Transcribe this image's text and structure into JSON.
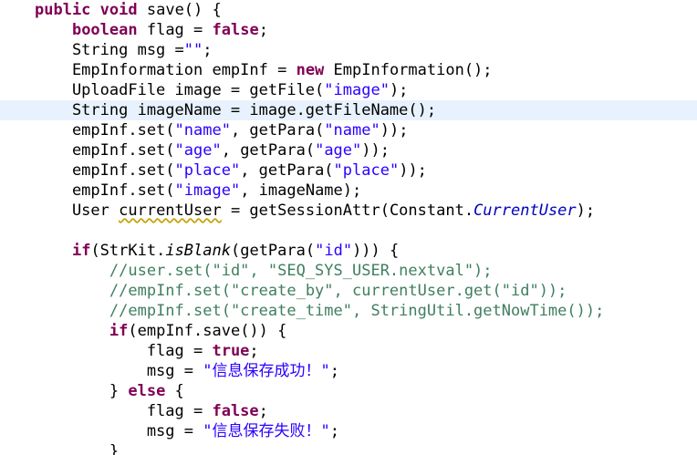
{
  "editor": {
    "theme": {
      "keyword_color": "#7f0055",
      "string_color": "#2a00ff",
      "comment_color": "#3f7f5f",
      "field_color": "#0000c0",
      "current_line_color": "#e8f2fe"
    },
    "highlighted_line_index": 5,
    "lines": [
      [
        {
          "t": "public",
          "c": "kw"
        },
        {
          "t": " "
        },
        {
          "t": "void",
          "c": "kw"
        },
        {
          "t": " save() {"
        }
      ],
      [
        {
          "t": "    "
        },
        {
          "t": "boolean",
          "c": "kw"
        },
        {
          "t": " flag = "
        },
        {
          "t": "false",
          "c": "kw"
        },
        {
          "t": ";"
        }
      ],
      [
        {
          "t": "    String msg ="
        },
        {
          "t": "\"\"",
          "c": "str"
        },
        {
          "t": ";"
        }
      ],
      [
        {
          "t": "    EmpInformation empInf = "
        },
        {
          "t": "new",
          "c": "kw"
        },
        {
          "t": " EmpInformation();"
        }
      ],
      [
        {
          "t": "    UploadFile image = getFile("
        },
        {
          "t": "\"image\"",
          "c": "str"
        },
        {
          "t": ");"
        }
      ],
      [
        {
          "t": "    String imageName = image.getFileName();"
        }
      ],
      [
        {
          "t": "    empInf.set("
        },
        {
          "t": "\"name\"",
          "c": "str"
        },
        {
          "t": ", getPara("
        },
        {
          "t": "\"name\"",
          "c": "str"
        },
        {
          "t": "));"
        }
      ],
      [
        {
          "t": "    empInf.set("
        },
        {
          "t": "\"age\"",
          "c": "str"
        },
        {
          "t": ", getPara("
        },
        {
          "t": "\"age\"",
          "c": "str"
        },
        {
          "t": "));"
        }
      ],
      [
        {
          "t": "    empInf.set("
        },
        {
          "t": "\"place\"",
          "c": "str"
        },
        {
          "t": ", getPara("
        },
        {
          "t": "\"place\"",
          "c": "str"
        },
        {
          "t": "));"
        }
      ],
      [
        {
          "t": "    empInf.set("
        },
        {
          "t": "\"image\"",
          "c": "str"
        },
        {
          "t": ", imageName);"
        }
      ],
      [
        {
          "t": "    User "
        },
        {
          "t": "currentUser",
          "c": "warn"
        },
        {
          "t": " = getSessionAttr(Constant."
        },
        {
          "t": "CurrentUser",
          "c": "field"
        },
        {
          "t": ");"
        }
      ],
      [
        {
          "t": ""
        }
      ],
      [
        {
          "t": "    "
        },
        {
          "t": "if",
          "c": "kw"
        },
        {
          "t": "(StrKit."
        },
        {
          "t": "isBlank",
          "c": "ital"
        },
        {
          "t": "(getPara("
        },
        {
          "t": "\"id\"",
          "c": "str"
        },
        {
          "t": "))) {"
        }
      ],
      [
        {
          "t": "        "
        },
        {
          "t": "//user.set(\"id\", \"SEQ_SYS_USER.nextval\");",
          "c": "cmt"
        }
      ],
      [
        {
          "t": "        "
        },
        {
          "t": "//empInf.set(\"create_by\", currentUser.get(\"id\"));",
          "c": "cmt"
        }
      ],
      [
        {
          "t": "        "
        },
        {
          "t": "//empInf.set(\"create_time\", StringUtil.getNowTime());",
          "c": "cmt"
        }
      ],
      [
        {
          "t": "        "
        },
        {
          "t": "if",
          "c": "kw"
        },
        {
          "t": "(empInf.save()) {"
        }
      ],
      [
        {
          "t": "            flag = "
        },
        {
          "t": "true",
          "c": "kw"
        },
        {
          "t": ";"
        }
      ],
      [
        {
          "t": "            msg = "
        },
        {
          "t": "\"信息保存成功！\"",
          "c": "str"
        },
        {
          "t": ";"
        }
      ],
      [
        {
          "t": "        } "
        },
        {
          "t": "else",
          "c": "kw"
        },
        {
          "t": " {"
        }
      ],
      [
        {
          "t": "            flag = "
        },
        {
          "t": "false",
          "c": "kw"
        },
        {
          "t": ";"
        }
      ],
      [
        {
          "t": "            msg = "
        },
        {
          "t": "\"信息保存失败！\"",
          "c": "str"
        },
        {
          "t": ";"
        }
      ],
      [
        {
          "t": "        }"
        }
      ]
    ]
  }
}
